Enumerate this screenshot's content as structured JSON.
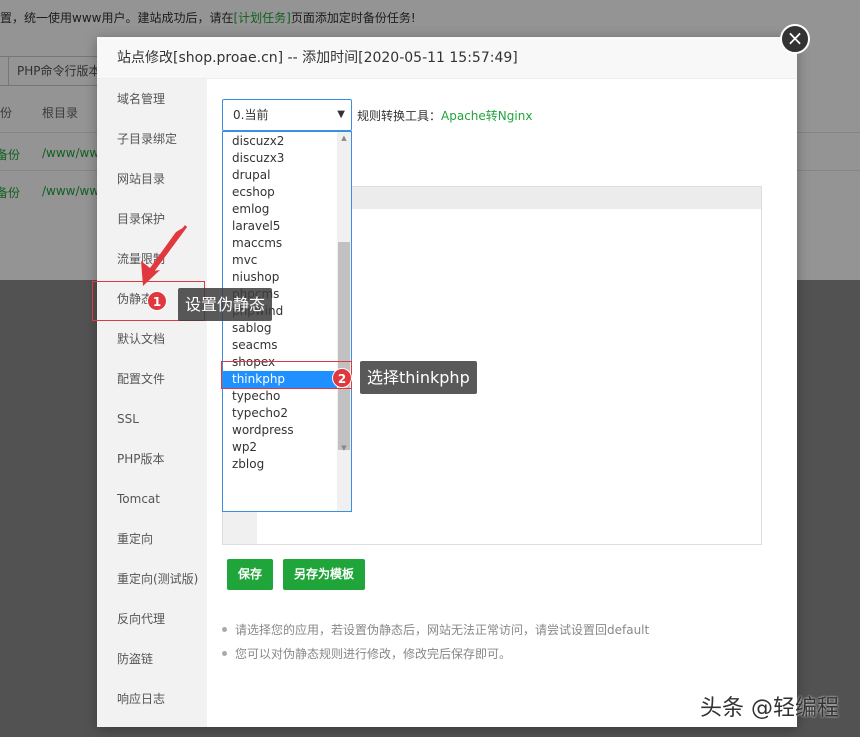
{
  "background": {
    "notice_prefix": "置，统一使用www用户。建站成功后，请在",
    "notice_link": "[计划任务]",
    "notice_suffix": "页面添加定时备份任务!",
    "php_cli_button": "PHP命令行版本",
    "col_backup": "份",
    "col_root": "根目录",
    "row1_backup": "备份",
    "row1_root": "/www/ww",
    "row2_backup": "备份",
    "row2_root": "/www/ww"
  },
  "dialog": {
    "title": "站点修改[shop.proae.cn] -- 添加时间[2020-05-11 15:57:49]",
    "close_icon": "close-icon",
    "sidebar": [
      {
        "label": "域名管理"
      },
      {
        "label": "子目录绑定"
      },
      {
        "label": "网站目录"
      },
      {
        "label": "目录保护"
      },
      {
        "label": "流量限制"
      },
      {
        "label": "伪静态"
      },
      {
        "label": "默认文档"
      },
      {
        "label": "配置文件"
      },
      {
        "label": "SSL"
      },
      {
        "label": "PHP版本"
      },
      {
        "label": "Tomcat"
      },
      {
        "label": "重定向"
      },
      {
        "label": "重定向(测试版)"
      },
      {
        "label": "反向代理"
      },
      {
        "label": "防盗链"
      },
      {
        "label": "响应日志"
      }
    ],
    "select_value": "0.当前",
    "tool_label": "规则转换工具：",
    "tool_link": "Apache转Nginx",
    "dropdown_options": [
      "discuzx2",
      "discuzx3",
      "drupal",
      "ecshop",
      "emlog",
      "laravel5",
      "maccms",
      "mvc",
      "niushop",
      "phpcms",
      "phpwind",
      "sablog",
      "seacms",
      "shopex",
      "thinkphp",
      "typecho",
      "typecho2",
      "wordpress",
      "wp2",
      "zblog"
    ],
    "selected_option": "thinkphp",
    "save_button": "保存",
    "save_template_button": "另存为模板",
    "tips": [
      "请选择您的应用，若设置伪静态后，网站无法正常访问，请尝试设置回default",
      "您可以对伪静态规则进行修改，修改完后保存即可。"
    ]
  },
  "annotations": {
    "step1_number": "1",
    "step1_text": "设置伪静态",
    "step2_number": "2",
    "step2_text": "选择thinkphp",
    "accent_color": "#e0383e"
  },
  "watermark": "头条 @轻编程",
  "colors": {
    "brand_green": "#20a53a",
    "selection_blue": "#1e90ff",
    "focus_border": "#3b8fe0"
  }
}
